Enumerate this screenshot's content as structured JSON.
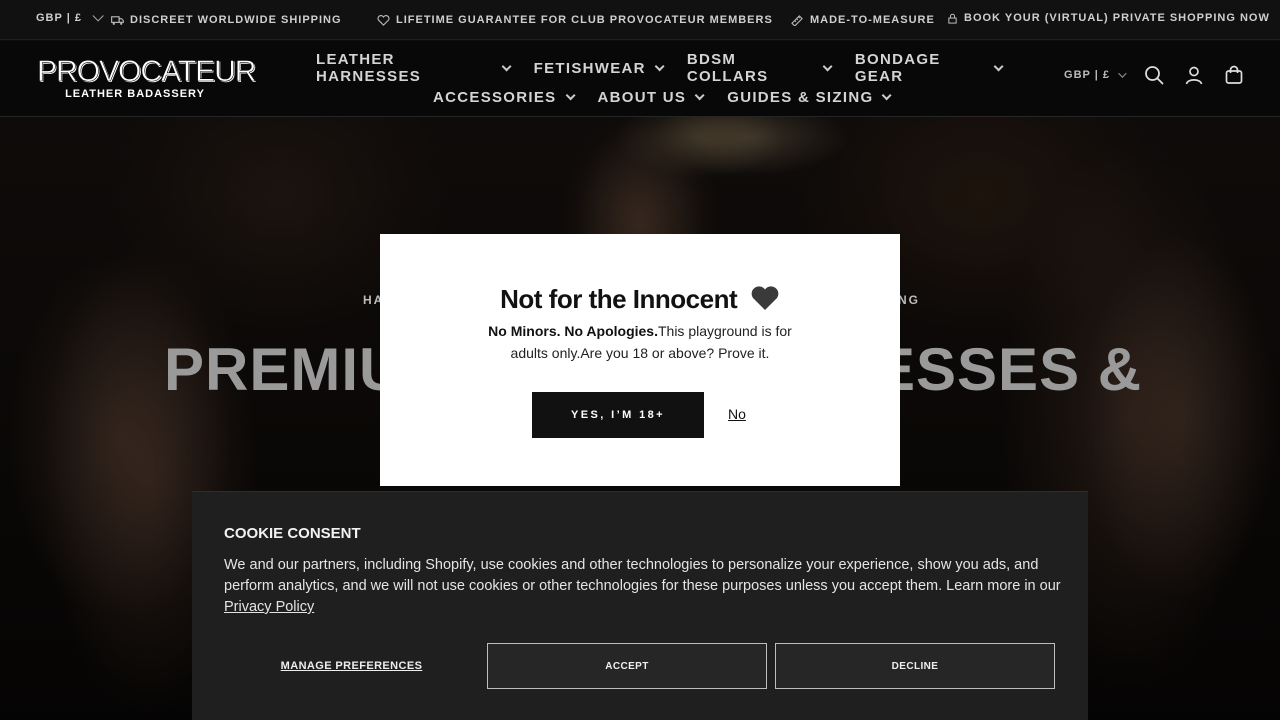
{
  "topbar": {
    "currency": "GBP | £",
    "items": [
      {
        "icon": "truck-icon",
        "label": "DISCREET WORLDWIDE SHIPPING"
      },
      {
        "icon": "heart-icon",
        "label": "LIFETIME GUARANTEE FOR CLUB PROVOCATEUR MEMBERS"
      },
      {
        "icon": "ruler-icon",
        "label": "MADE-TO-MEASURE"
      },
      {
        "icon": "lock-icon",
        "label": "BOOK YOUR (VIRTUAL) PRIVATE SHOPPING NOW"
      }
    ]
  },
  "header": {
    "logo_main": "PROVOCATEUR",
    "logo_sub": "LEATHER BADASSERY",
    "nav_row1": [
      "LEATHER HARNESSES",
      "FETISHWEAR",
      "BDSM COLLARS",
      "BONDAGE GEAR"
    ],
    "nav_row2": [
      "ACCESSORIES",
      "ABOUT US",
      "GUIDES & SIZING"
    ],
    "currency": "GBP | £"
  },
  "hero": {
    "subtitle_left": "HA",
    "subtitle_right": "NG",
    "title_left": "PREMIU",
    "title_right": "ESSES &"
  },
  "age_modal": {
    "title": "Not for the Innocent",
    "heart": "🖤",
    "bold_text": "No Minors. No Apologies.",
    "text": "This playground is for adults only.Are you 18 or above? Prove it.",
    "yes_label": "YES, I’M 18+",
    "no_label": "No"
  },
  "cookie": {
    "title": "COOKIE CONSENT",
    "body": "We and our partners, including Shopify, use cookies and other technologies to personalize your experience, show you ads, and perform analytics, and we will not use cookies or other technologies for these purposes unless you accept them. Learn more in our ",
    "link": "Privacy Policy",
    "manage_label": "MANAGE PREFERENCES",
    "accept_label": "ACCEPT",
    "decline_label": "DECLINE"
  },
  "colors": {
    "topbar_bg": "#111111",
    "modal_bg": "#ffffff",
    "cookie_bg": "#1f1f1f",
    "button_dark": "#111111"
  }
}
